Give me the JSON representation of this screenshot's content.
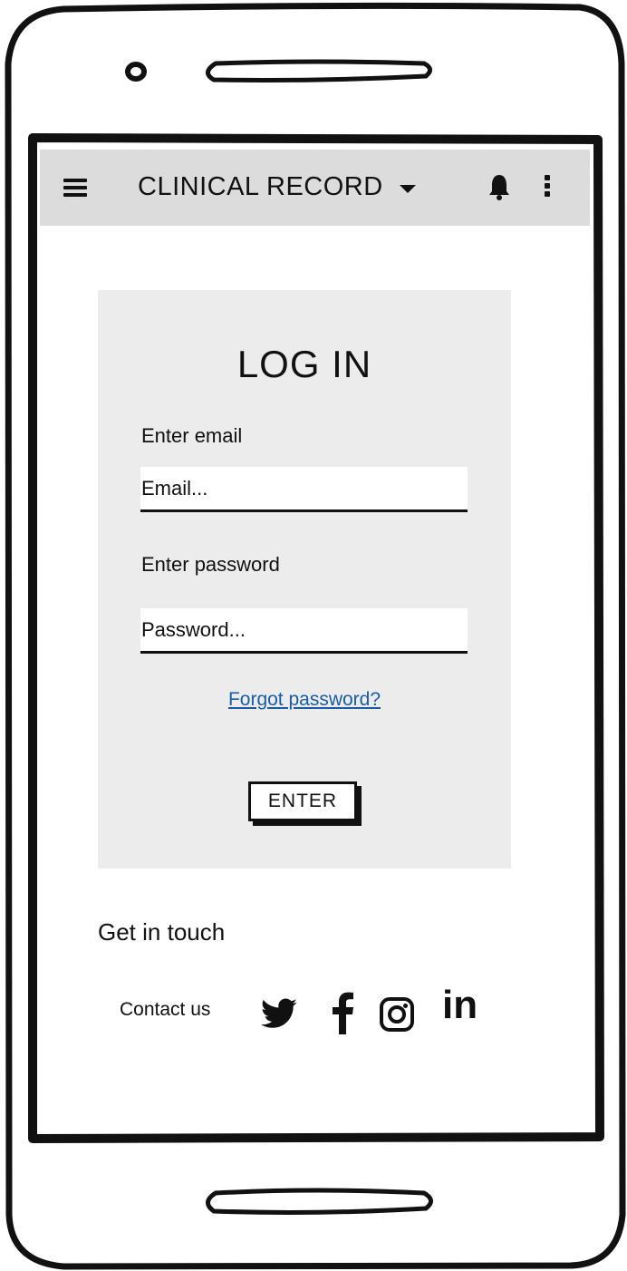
{
  "app_bar": {
    "menu_icon": "hamburger-menu-icon",
    "title": "CLINICAL RECORD",
    "dropdown_icon": "caret-down-icon",
    "notification_icon": "bell-icon",
    "overflow_icon": "vertical-dots-icon"
  },
  "login": {
    "title": "LOG IN",
    "email_label": "Enter email",
    "email_placeholder": "Email...",
    "email_value": "",
    "password_label": "Enter password",
    "password_placeholder": "Password...",
    "password_value": "",
    "forgot_link": "Forgot password?",
    "submit_label": "ENTER"
  },
  "footer": {
    "heading": "Get in touch",
    "contact_label": "Contact us",
    "social_icons": [
      "twitter-icon",
      "facebook-icon",
      "instagram-icon",
      "linkedin-icon"
    ],
    "linkedin_text": "in"
  },
  "colors": {
    "app_bar_bg": "#dcdcdc",
    "card_bg": "#ececec",
    "link": "#1a5ba8",
    "text": "#111111"
  }
}
